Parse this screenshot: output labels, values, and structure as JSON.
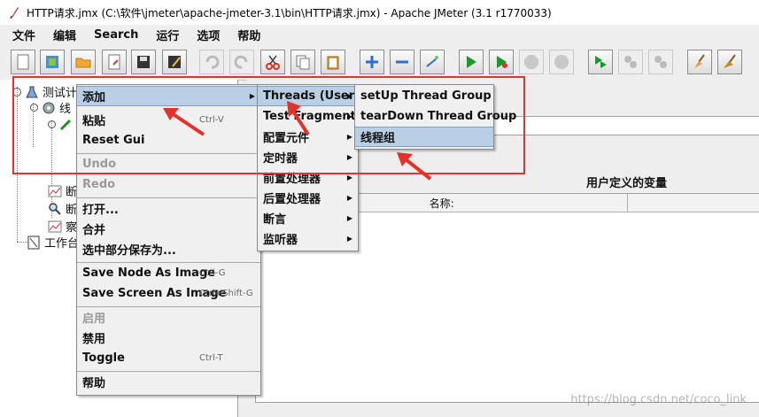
{
  "window": {
    "title": "HTTP请求.jmx (C:\\软件\\jmeter\\apache-jmeter-3.1\\bin\\HTTP请求.jmx) - Apache JMeter (3.1 r1770033)"
  },
  "menubar": [
    "文件",
    "编辑",
    "Search",
    "运行",
    "选项",
    "帮助"
  ],
  "tree": {
    "nodes": [
      {
        "label": "测试计"
      },
      {
        "label": "线"
      },
      {
        "label": "断"
      },
      {
        "label": "断"
      },
      {
        "label": "察"
      },
      {
        "label": "工作台"
      }
    ]
  },
  "right_panel": {
    "vars_title": "用户定义的变量",
    "columns": [
      "名称:",
      ""
    ]
  },
  "context_menu": {
    "items": [
      {
        "label": "添加",
        "accel": "",
        "submenu": true,
        "disabled": false,
        "selected": true
      },
      {
        "label": "粘贴",
        "accel": "Ctrl-V"
      },
      {
        "label": "Reset Gui",
        "accel": ""
      },
      {
        "label": "Undo",
        "accel": "",
        "disabled": true
      },
      {
        "label": "Redo",
        "accel": "",
        "disabled": true
      },
      {
        "label": "打开...",
        "accel": ""
      },
      {
        "label": "合并",
        "accel": ""
      },
      {
        "label": "选中部分保存为...",
        "accel": ""
      },
      {
        "label": "Save Node As Image",
        "accel": "Ctrl-G"
      },
      {
        "label": "Save Screen As Image",
        "accel": "Ctrl+Shift-G"
      },
      {
        "label": "启用",
        "accel": "",
        "disabled": true
      },
      {
        "label": "禁用",
        "accel": ""
      },
      {
        "label": "Toggle",
        "accel": "Ctrl-T"
      },
      {
        "label": "帮助",
        "accel": ""
      }
    ]
  },
  "add_submenu": {
    "items": [
      {
        "label": "Threads (Users)",
        "selected": true
      },
      {
        "label": "Test Fragment"
      },
      {
        "label": "配置元件"
      },
      {
        "label": "定时器"
      },
      {
        "label": "前置处理器"
      },
      {
        "label": "后置处理器"
      },
      {
        "label": "断言"
      },
      {
        "label": "监听器"
      }
    ]
  },
  "threads_submenu": {
    "items": [
      {
        "label": "setUp Thread Group"
      },
      {
        "label": "tearDown Thread Group"
      },
      {
        "label": "线程组",
        "selected": true
      }
    ]
  },
  "watermark": "https://blog.csdn.net/coco_link",
  "colors": {
    "highlight": "#b8cfe5",
    "annotation_red": "#e4312b"
  }
}
